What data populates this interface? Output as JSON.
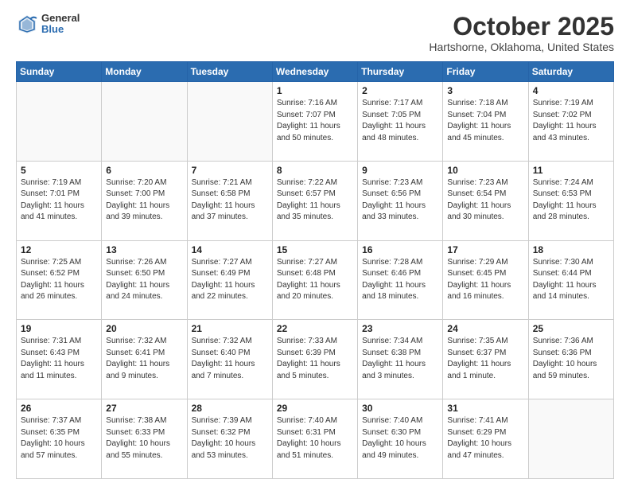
{
  "header": {
    "logo_general": "General",
    "logo_blue": "Blue",
    "month_title": "October 2025",
    "location": "Hartshorne, Oklahoma, United States"
  },
  "weekdays": [
    "Sunday",
    "Monday",
    "Tuesday",
    "Wednesday",
    "Thursday",
    "Friday",
    "Saturday"
  ],
  "weeks": [
    [
      {
        "day": "",
        "info": ""
      },
      {
        "day": "",
        "info": ""
      },
      {
        "day": "",
        "info": ""
      },
      {
        "day": "1",
        "info": "Sunrise: 7:16 AM\nSunset: 7:07 PM\nDaylight: 11 hours\nand 50 minutes."
      },
      {
        "day": "2",
        "info": "Sunrise: 7:17 AM\nSunset: 7:05 PM\nDaylight: 11 hours\nand 48 minutes."
      },
      {
        "day": "3",
        "info": "Sunrise: 7:18 AM\nSunset: 7:04 PM\nDaylight: 11 hours\nand 45 minutes."
      },
      {
        "day": "4",
        "info": "Sunrise: 7:19 AM\nSunset: 7:02 PM\nDaylight: 11 hours\nand 43 minutes."
      }
    ],
    [
      {
        "day": "5",
        "info": "Sunrise: 7:19 AM\nSunset: 7:01 PM\nDaylight: 11 hours\nand 41 minutes."
      },
      {
        "day": "6",
        "info": "Sunrise: 7:20 AM\nSunset: 7:00 PM\nDaylight: 11 hours\nand 39 minutes."
      },
      {
        "day": "7",
        "info": "Sunrise: 7:21 AM\nSunset: 6:58 PM\nDaylight: 11 hours\nand 37 minutes."
      },
      {
        "day": "8",
        "info": "Sunrise: 7:22 AM\nSunset: 6:57 PM\nDaylight: 11 hours\nand 35 minutes."
      },
      {
        "day": "9",
        "info": "Sunrise: 7:23 AM\nSunset: 6:56 PM\nDaylight: 11 hours\nand 33 minutes."
      },
      {
        "day": "10",
        "info": "Sunrise: 7:23 AM\nSunset: 6:54 PM\nDaylight: 11 hours\nand 30 minutes."
      },
      {
        "day": "11",
        "info": "Sunrise: 7:24 AM\nSunset: 6:53 PM\nDaylight: 11 hours\nand 28 minutes."
      }
    ],
    [
      {
        "day": "12",
        "info": "Sunrise: 7:25 AM\nSunset: 6:52 PM\nDaylight: 11 hours\nand 26 minutes."
      },
      {
        "day": "13",
        "info": "Sunrise: 7:26 AM\nSunset: 6:50 PM\nDaylight: 11 hours\nand 24 minutes."
      },
      {
        "day": "14",
        "info": "Sunrise: 7:27 AM\nSunset: 6:49 PM\nDaylight: 11 hours\nand 22 minutes."
      },
      {
        "day": "15",
        "info": "Sunrise: 7:27 AM\nSunset: 6:48 PM\nDaylight: 11 hours\nand 20 minutes."
      },
      {
        "day": "16",
        "info": "Sunrise: 7:28 AM\nSunset: 6:46 PM\nDaylight: 11 hours\nand 18 minutes."
      },
      {
        "day": "17",
        "info": "Sunrise: 7:29 AM\nSunset: 6:45 PM\nDaylight: 11 hours\nand 16 minutes."
      },
      {
        "day": "18",
        "info": "Sunrise: 7:30 AM\nSunset: 6:44 PM\nDaylight: 11 hours\nand 14 minutes."
      }
    ],
    [
      {
        "day": "19",
        "info": "Sunrise: 7:31 AM\nSunset: 6:43 PM\nDaylight: 11 hours\nand 11 minutes."
      },
      {
        "day": "20",
        "info": "Sunrise: 7:32 AM\nSunset: 6:41 PM\nDaylight: 11 hours\nand 9 minutes."
      },
      {
        "day": "21",
        "info": "Sunrise: 7:32 AM\nSunset: 6:40 PM\nDaylight: 11 hours\nand 7 minutes."
      },
      {
        "day": "22",
        "info": "Sunrise: 7:33 AM\nSunset: 6:39 PM\nDaylight: 11 hours\nand 5 minutes."
      },
      {
        "day": "23",
        "info": "Sunrise: 7:34 AM\nSunset: 6:38 PM\nDaylight: 11 hours\nand 3 minutes."
      },
      {
        "day": "24",
        "info": "Sunrise: 7:35 AM\nSunset: 6:37 PM\nDaylight: 11 hours\nand 1 minute."
      },
      {
        "day": "25",
        "info": "Sunrise: 7:36 AM\nSunset: 6:36 PM\nDaylight: 10 hours\nand 59 minutes."
      }
    ],
    [
      {
        "day": "26",
        "info": "Sunrise: 7:37 AM\nSunset: 6:35 PM\nDaylight: 10 hours\nand 57 minutes."
      },
      {
        "day": "27",
        "info": "Sunrise: 7:38 AM\nSunset: 6:33 PM\nDaylight: 10 hours\nand 55 minutes."
      },
      {
        "day": "28",
        "info": "Sunrise: 7:39 AM\nSunset: 6:32 PM\nDaylight: 10 hours\nand 53 minutes."
      },
      {
        "day": "29",
        "info": "Sunrise: 7:40 AM\nSunset: 6:31 PM\nDaylight: 10 hours\nand 51 minutes."
      },
      {
        "day": "30",
        "info": "Sunrise: 7:40 AM\nSunset: 6:30 PM\nDaylight: 10 hours\nand 49 minutes."
      },
      {
        "day": "31",
        "info": "Sunrise: 7:41 AM\nSunset: 6:29 PM\nDaylight: 10 hours\nand 47 minutes."
      },
      {
        "day": "",
        "info": ""
      }
    ]
  ]
}
